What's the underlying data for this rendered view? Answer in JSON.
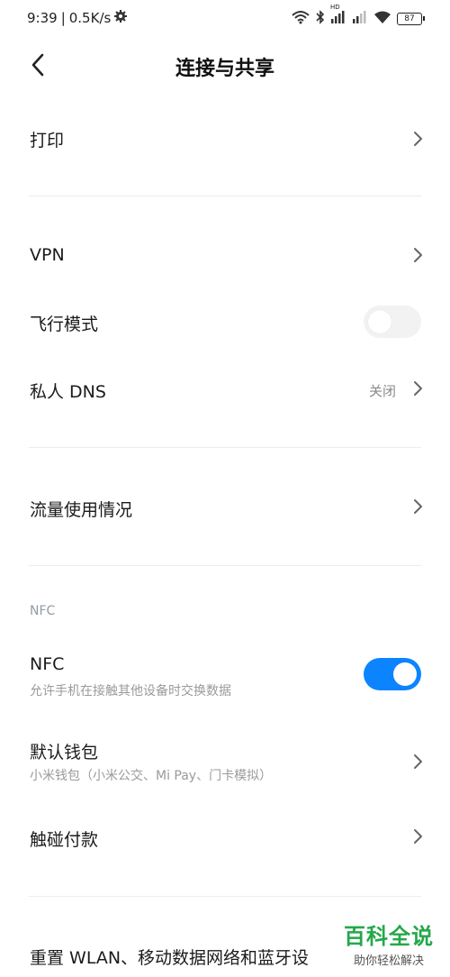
{
  "status_bar": {
    "time": "9:39",
    "speed": "0.5K/s",
    "separator": "|",
    "battery": "87",
    "hd": "HD"
  },
  "header": {
    "title": "连接与共享"
  },
  "items": {
    "print": "打印",
    "vpn": "VPN",
    "airplane": "飞行模式",
    "private_dns": "私人 DNS",
    "private_dns_value": "关闭",
    "data_usage": "流量使用情况",
    "nfc_section": "NFC",
    "nfc": "NFC",
    "nfc_sub": "允许手机在接触其他设备时交换数据",
    "wallet": "默认钱包",
    "wallet_sub": "小米钱包（小米公交、Mi Pay、门卡模拟）",
    "tap_pay": "触碰付款",
    "reset": "重置 WLAN、移动数据网络和蓝牙设"
  },
  "toggles": {
    "airplane_on": false,
    "nfc_on": true
  },
  "watermark": {
    "title": "百科全说",
    "subtitle": "助你轻松解决"
  },
  "colors": {
    "accent": "#0d84ff",
    "watermark": "#24a84a"
  }
}
